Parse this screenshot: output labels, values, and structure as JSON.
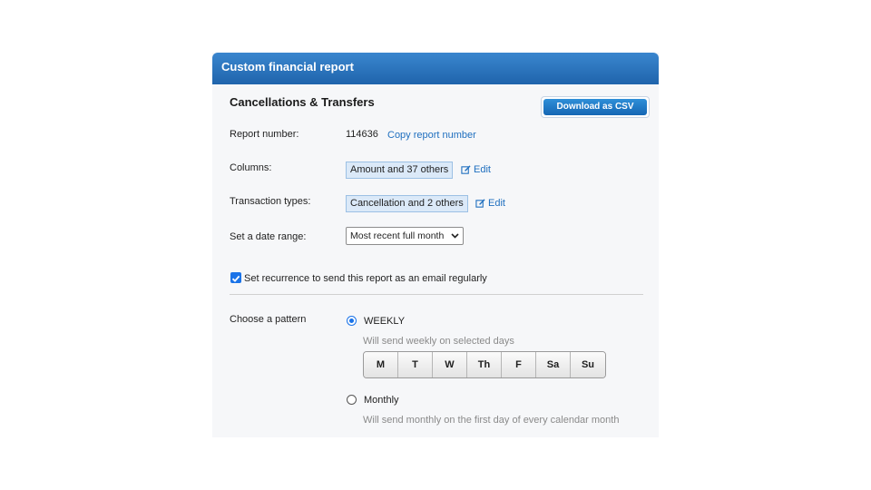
{
  "header": {
    "title": "Custom financial report"
  },
  "report": {
    "title": "Cancellations & Transfers",
    "download_label": "Download as CSV",
    "number_label": "Report number:",
    "number_value": "114636",
    "copy_label": "Copy report number",
    "columns_label": "Columns:",
    "columns_value": "Amount and 37 others",
    "types_label": "Transaction types:",
    "types_value": "Cancellation and 2 others",
    "edit_label": "Edit",
    "date_label": "Set a date range:",
    "date_value": "Most recent full month"
  },
  "recurrence": {
    "checked": true,
    "label": "Set recurrence to send this report as an email regularly",
    "pattern_label": "Choose a pattern",
    "weekly_label": "WEEKLY",
    "weekly_hint": "Will send weekly on selected days",
    "days": [
      "M",
      "T",
      "W",
      "Th",
      "F",
      "Sa",
      "Su"
    ],
    "monthly_label": "Monthly",
    "monthly_hint": "Will send monthly on the first day of every calendar month",
    "selected": "weekly"
  },
  "colors": {
    "header_bg": "#2a74be",
    "link": "#1f6fbf",
    "tag_bg": "#dbe9f8",
    "accent": "#1a73e8"
  }
}
